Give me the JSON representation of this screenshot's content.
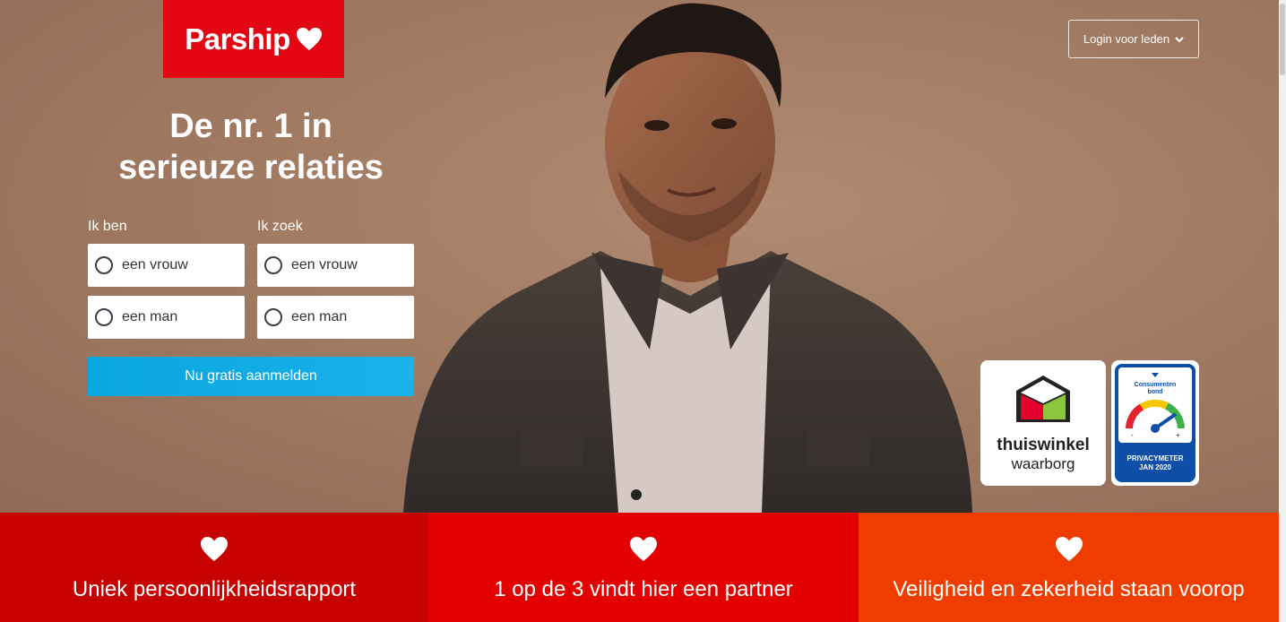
{
  "brand": {
    "name": "Parship",
    "color": "#e30613"
  },
  "header": {
    "login_label": "Login voor leden"
  },
  "hero": {
    "headline_line1": "De nr. 1 in",
    "headline_line2": "serieuze relaties"
  },
  "form": {
    "ik_ben_label": "Ik ben",
    "ik_zoek_label": "Ik zoek",
    "options": {
      "vrouw": "een vrouw",
      "man": "een man"
    },
    "submit_label": "Nu gratis aanmelden"
  },
  "badges": {
    "thuiswinkel_line1": "thuiswinkel",
    "thuiswinkel_line2": "waarborg",
    "consumentenbond_line1": "Consumenten",
    "consumentenbond_line2": "bond",
    "privacymeter_line1": "PRIVACYMETER",
    "privacymeter_line2": "JAN 2020"
  },
  "features": [
    {
      "label": "Uniek persoonlijkheidsrapport",
      "color": "#c70000"
    },
    {
      "label": "1 op de 3 vindt hier een partner",
      "color": "#e30000"
    },
    {
      "label": "Veiligheid en zekerheid staan voorop",
      "color": "#ef3d00"
    }
  ]
}
